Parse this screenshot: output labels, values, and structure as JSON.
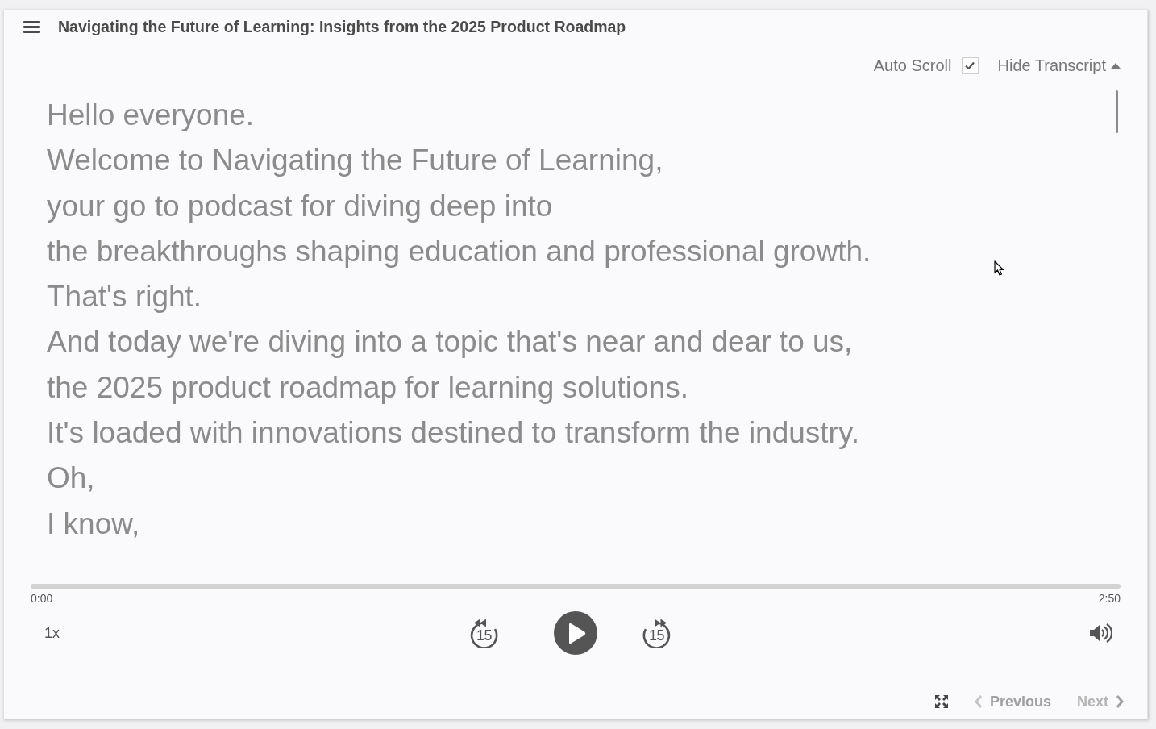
{
  "header": {
    "title": "Navigating the Future of Learning: Insights from the 2025 Product Roadmap"
  },
  "transcript_controls": {
    "auto_scroll": {
      "label": "Auto Scroll",
      "checked": true
    },
    "toggle": {
      "label": "Hide Transcript",
      "expanded": true
    }
  },
  "transcript": {
    "lines": [
      "Hello everyone.",
      "Welcome to Navigating the Future of Learning,",
      "your go to podcast for diving deep into",
      "the breakthroughs shaping education and professional growth.",
      "That's right.",
      "And today we're diving into a topic that's near and dear to us,",
      "the 2025 product roadmap for learning solutions.",
      "It's loaded with innovations destined to transform the industry.",
      "Oh,",
      "I know,"
    ]
  },
  "player": {
    "elapsed": "0:00",
    "duration": "2:50",
    "speed": "1x",
    "skip_back": "15",
    "skip_forward": "15",
    "playing": false
  },
  "navigation": [
    {
      "label": "Previous",
      "kind": "previous",
      "disabled": false
    },
    {
      "label": "Next",
      "kind": "next",
      "disabled": true
    }
  ]
}
